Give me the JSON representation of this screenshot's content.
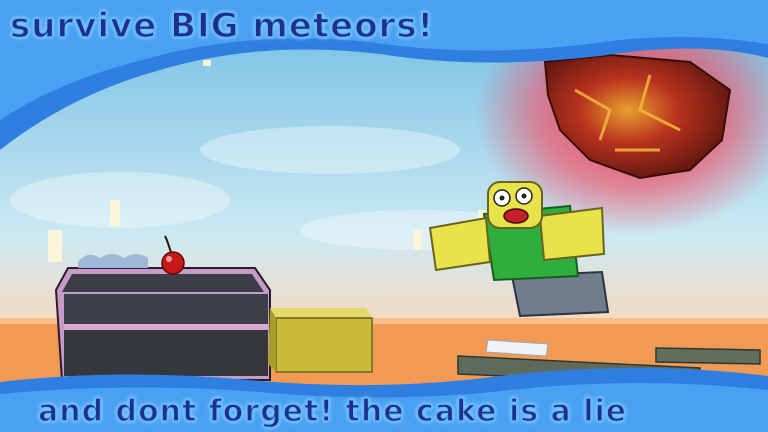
{
  "top_banner": {
    "text": "survive BIG meteors!"
  },
  "bottom_banner": {
    "text": "and dont forget! the cake is a lie"
  },
  "colors": {
    "sky": "#9fd3ec",
    "lava_floor": "#f09a55",
    "frame_blue": "#2f7fe0",
    "caption_text": "#1f2f8a",
    "meteor_core": "#b8321d",
    "meteor_glow": "#ff3b4f",
    "avatar_yellow": "#e8e24b",
    "avatar_green": "#2fae3b",
    "avatar_legs": "#6f7d8f"
  },
  "scene": {
    "objects": [
      "meteor",
      "avatar",
      "cake-slice",
      "cherry",
      "yellow-block",
      "floating-platforms"
    ]
  }
}
